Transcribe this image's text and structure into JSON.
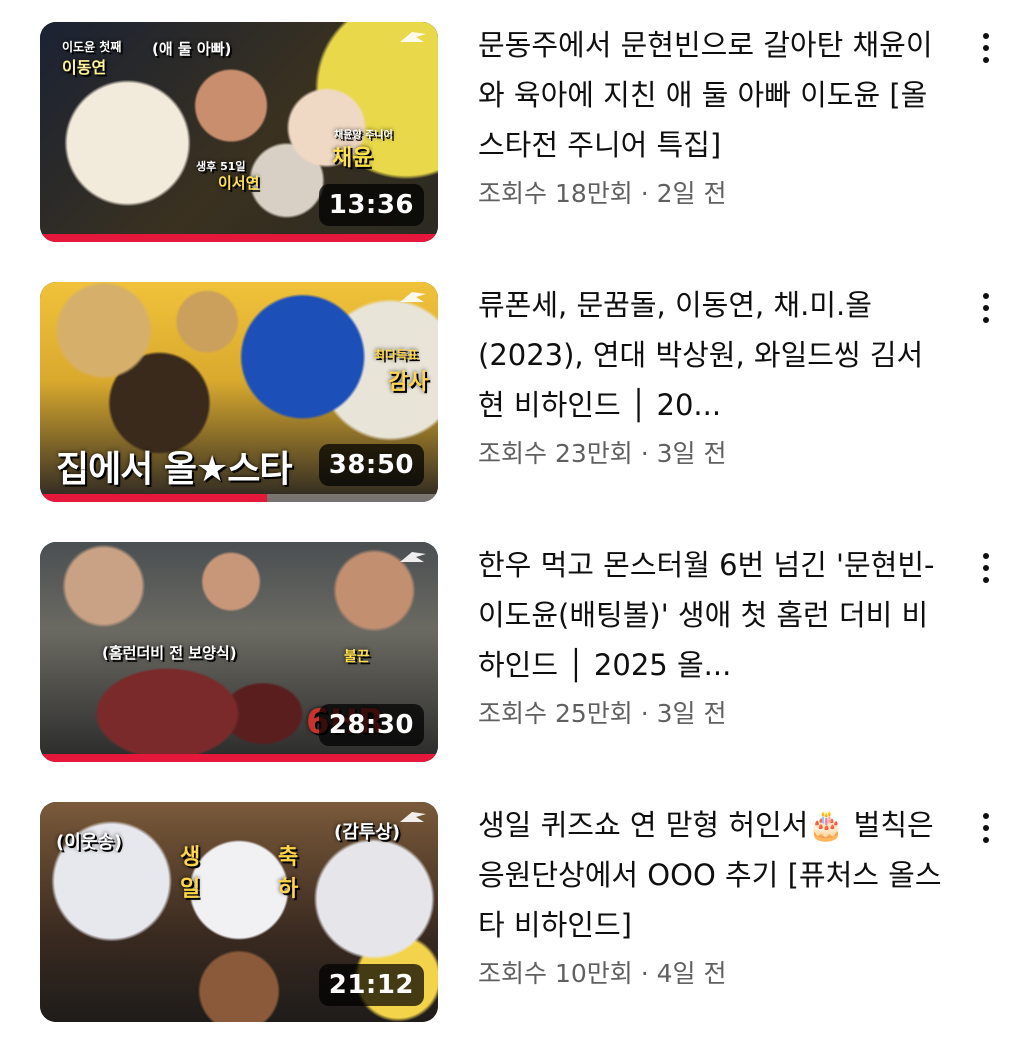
{
  "videos": [
    {
      "title": "문동주에서 문현빈으로 갈아탄 채윤이와 육아에 지친 애 둘 아빠 이도윤 [올스타전 주니어 특집]",
      "views": "조회수 18만회",
      "separator": "·",
      "age": "2일 전",
      "duration": "13:36",
      "progress": 1.0,
      "thumb_text": [
        "이도윤 첫째",
        "이동연",
        "(애 둘 아빠)",
        "생후 51일",
        "이서연",
        "채윤",
        "채윤양 주니어"
      ]
    },
    {
      "title": "류폰세, 문꿈돌, 이동연, 채.미.올(2023), 연대 박상원, 와일드씽 김서현 비하인드 │ 20...",
      "views": "조회수 23만회",
      "separator": "·",
      "age": "3일 전",
      "duration": "38:50",
      "progress": 0.57,
      "thumb_text": [
        "집에서 올★스타",
        "최다득표",
        "감사"
      ]
    },
    {
      "title": "한우 먹고 몬스터월 6번 넘긴 '문현빈-이도윤(배팅볼)' 생애 첫 홈런 더비 비하인드 │ 2025 올...",
      "views": "조회수 25만회",
      "separator": "·",
      "age": "3일 전",
      "duration": "28:30",
      "progress": 1.0,
      "thumb_text": [
        "(홈런더비 전 보양식)",
        "불끈",
        "6HR"
      ]
    },
    {
      "title": "생일 퀴즈쇼 연 맏형 허인서🎂 벌칙은 응원단상에서 OOO 추기 [퓨처스 올스타 비하인드]",
      "views": "조회수 10만회",
      "separator": "·",
      "age": "4일 전",
      "duration": "21:12",
      "progress": 0,
      "thumb_text": [
        "(이웃송)",
        "생일",
        "축하",
        "(감투상)"
      ]
    }
  ],
  "icons": {
    "more": "more-vert-icon",
    "channel_logo": "eagle-logo-icon"
  },
  "colors": {
    "progress": "#e5173a",
    "title": "#0f0f0f",
    "meta": "#606060",
    "duration_bg": "rgba(0,0,0,0.72)"
  }
}
